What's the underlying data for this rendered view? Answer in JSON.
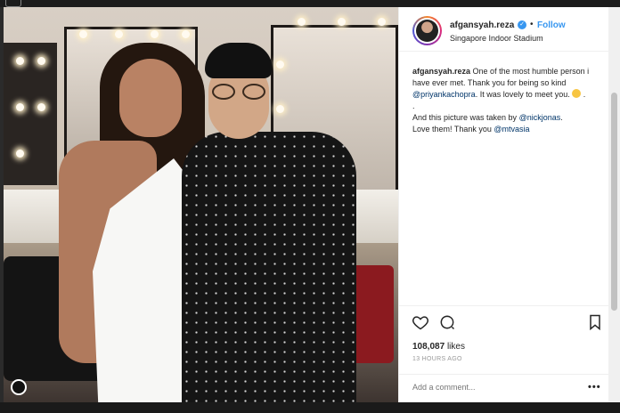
{
  "post": {
    "username": "afgansyah.reza",
    "verified_icon": "verified-badge-icon",
    "separator": "•",
    "follow_label": "Follow",
    "location": "Singapore Indoor Stadium",
    "caption": {
      "user": "afgansyah.reza",
      "text1": "One of the most humble person i have ever met. Thank you for being so kind",
      "mention1": "@priyankachopra",
      "text2": ". It was lovely to meet you.",
      "text3": ".",
      "text4": ".",
      "text5": "And this picture was taken by",
      "mention2": "@nickjonas",
      "text6": ".",
      "text7": "Love them! Thank you",
      "mention3": "@mtvasia",
      "text8": "."
    },
    "likes_count": "108,087",
    "likes_label": "likes",
    "time_ago": "13 HOURS AGO",
    "comment_placeholder": "Add a comment...",
    "more_label": "•••"
  },
  "colors": {
    "link": "#3897f0",
    "mention": "#003569",
    "text": "#262626",
    "muted": "#999999"
  }
}
